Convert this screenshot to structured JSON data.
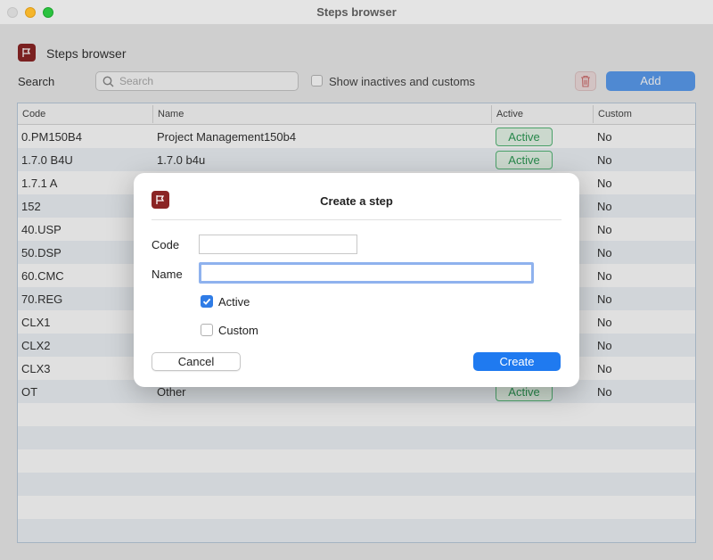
{
  "window": {
    "title": "Steps browser"
  },
  "header": {
    "app_name": "Steps browser"
  },
  "toolbar": {
    "search_label": "Search",
    "search_placeholder": "Search",
    "show_inactive_label": "Show inactives and customs",
    "add_label": "Add"
  },
  "table": {
    "columns": [
      "Code",
      "Name",
      "Active",
      "Custom"
    ],
    "rows": [
      {
        "code": "0.PM150B4",
        "name": "Project Management150b4",
        "active": "Active",
        "custom": "No"
      },
      {
        "code": "1.7.0 B4U",
        "name": "1.7.0 b4u",
        "active": "Active",
        "custom": "No"
      },
      {
        "code": "1.7.1 A",
        "name": "",
        "active": "",
        "custom": "No"
      },
      {
        "code": "152",
        "name": "",
        "active": "",
        "custom": "No"
      },
      {
        "code": "40.USP",
        "name": "",
        "active": "",
        "custom": "No"
      },
      {
        "code": "50.DSP",
        "name": "",
        "active": "",
        "custom": "No"
      },
      {
        "code": "60.CMC",
        "name": "",
        "active": "",
        "custom": "No"
      },
      {
        "code": "70.REG",
        "name": "",
        "active": "",
        "custom": "No"
      },
      {
        "code": "CLX1",
        "name": "",
        "active": "",
        "custom": "No"
      },
      {
        "code": "CLX2",
        "name": "",
        "active": "",
        "custom": "No"
      },
      {
        "code": "CLX3",
        "name": "",
        "active": "",
        "custom": "No"
      },
      {
        "code": "OT",
        "name": "Other",
        "active": "Active",
        "custom": "No"
      }
    ]
  },
  "dialog": {
    "title": "Create a step",
    "code_label": "Code",
    "code_value": "",
    "name_label": "Name",
    "name_value": "",
    "active_label": "Active",
    "active_checked": true,
    "custom_label": "Custom",
    "custom_checked": false,
    "cancel_label": "Cancel",
    "create_label": "Create"
  },
  "colors": {
    "brand": "#8b2525",
    "accent": "#1f7af0",
    "active_badge": "#2d9a55"
  }
}
